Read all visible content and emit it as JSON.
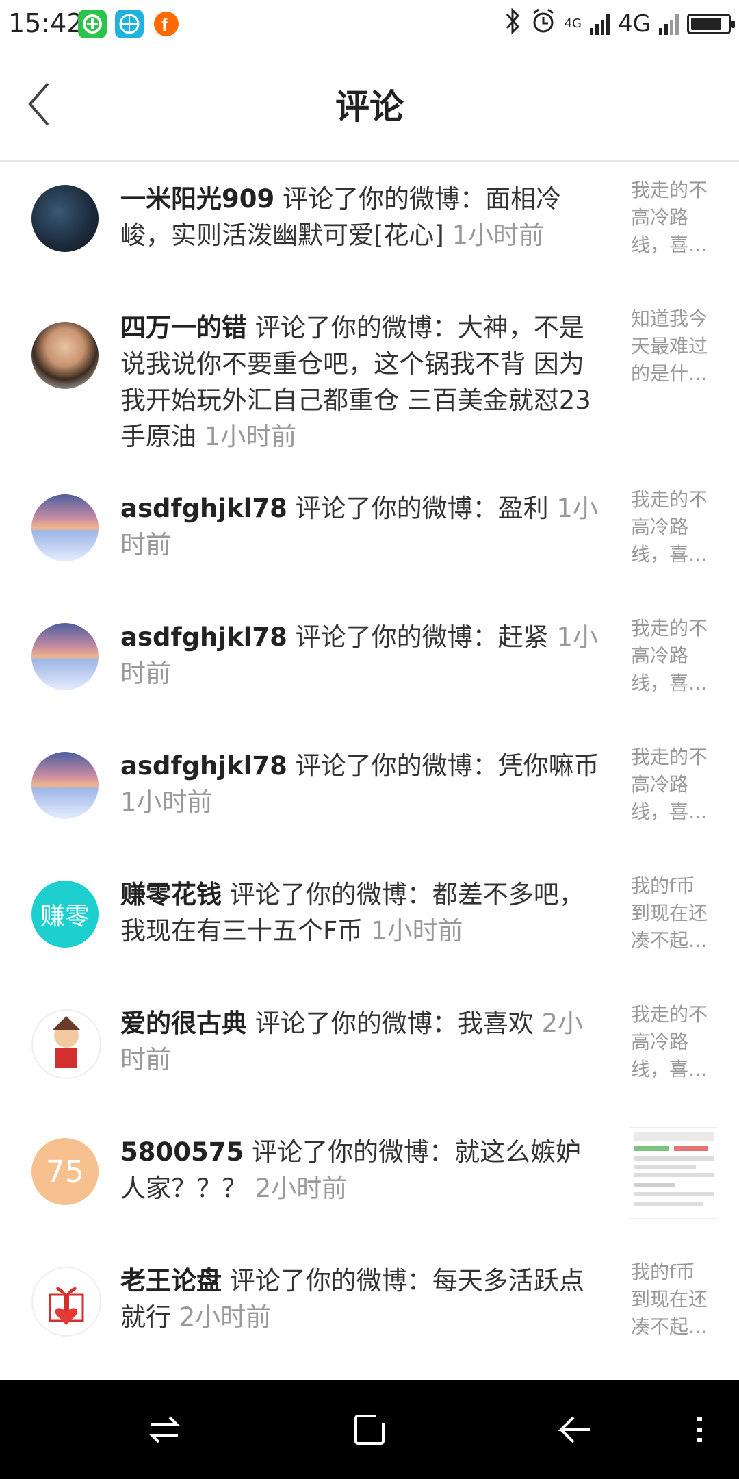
{
  "status_bar": {
    "time": "15:42",
    "network_1": "4G",
    "network_2": "4G",
    "icons": [
      "wechat-app-icon",
      "basketball-app-icon",
      "f-app-icon",
      "bluetooth-icon",
      "alarm-icon",
      "signal-icon",
      "battery-icon"
    ],
    "battery_level": 0.85
  },
  "header": {
    "title": "评论",
    "back_icon": "chevron-left-icon"
  },
  "comments": [
    {
      "user": "一米阳光909",
      "action": " 评论了你的微博：",
      "text": "面相冷峻，实则活泼幽默可爱[花心]",
      "time": " 1小时前",
      "preview": "我走的不高冷路线，喜…",
      "avatar": "dark-poster",
      "avatar_text": ""
    },
    {
      "user": "四万一的错",
      "action": " 评论了你的微博：",
      "text": "大神，不是说我说你不要重仓吧，这个锅我不背 因为我开始玩外汇自己都重仓 三百美金就怼23手原油",
      "time": " 1小时前",
      "preview": "知道我今天最难过的是什…",
      "avatar": "photo",
      "avatar_text": ""
    },
    {
      "user": "asdfghjkl78",
      "action": " 评论了你的微博：",
      "text": "盈利",
      "time": " 1小时前",
      "preview": "我走的不高冷路线，喜…",
      "avatar": "sunset",
      "avatar_text": ""
    },
    {
      "user": "asdfghjkl78",
      "action": " 评论了你的微博：",
      "text": "赶紧",
      "time": " 1小时前",
      "preview": "我走的不高冷路线，喜…",
      "avatar": "sunset",
      "avatar_text": ""
    },
    {
      "user": "asdfghjkl78",
      "action": " 评论了你的微博：",
      "text": "凭你嘛币",
      "time": " 1小时前",
      "preview": "我走的不高冷路线，喜…",
      "avatar": "sunset",
      "avatar_text": ""
    },
    {
      "user": "赚零花钱",
      "action": " 评论了你的微博：",
      "text": "都差不多吧，我现在有三十五个F币",
      "time": " 1小时前",
      "preview": "我的f币到现在还凑不起…",
      "avatar": "text",
      "avatar_text": "赚零"
    },
    {
      "user": "爱的很古典",
      "action": " 评论了你的微博：",
      "text": "我喜欢",
      "time": " 2小时前",
      "preview": "我走的不高冷路线，喜…",
      "avatar": "cartoon",
      "avatar_text": ""
    },
    {
      "user": "5800575",
      "action": " 评论了你的微博：",
      "text": "就这么嫉妒人家？？？ ",
      "time": " 2小时前",
      "preview": "",
      "avatar": "number",
      "avatar_text": "75"
    },
    {
      "user": "老王论盘",
      "action": " 评论了你的微博：",
      "text": "每天多活跃点就行",
      "time": " 2小时前",
      "preview": "我的f币到现在还凑不起…",
      "avatar": "gift",
      "avatar_text": ""
    }
  ],
  "nav_bar": {
    "icons": [
      "switch-icon",
      "home-square-icon",
      "back-arrow-icon",
      "menu-icon"
    ]
  },
  "colors": {
    "accent_teal": "#1ecfcf",
    "avatar_peach": "#f6c08f",
    "secondary_text": "#999999"
  }
}
